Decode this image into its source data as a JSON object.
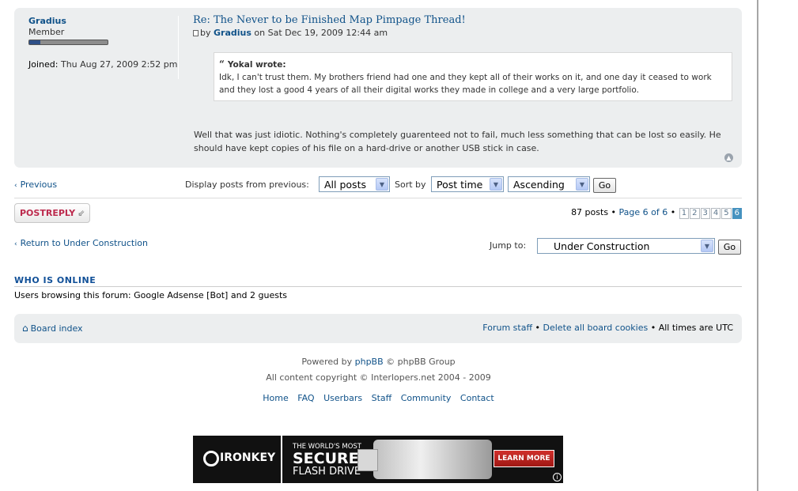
{
  "post": {
    "author_name": "Gradius",
    "rank": "Member",
    "joined_label": "Joined:",
    "joined_value": "Thu Aug 27, 2009 2:52 pm",
    "title": "Re: The Never to be Finished Map Pimpage Thread!",
    "by_prefix": "by",
    "by_name": "Gradius",
    "by_date": "on Sat Dec 19, 2009 12:44 am",
    "quote_author": "Yokal wrote:",
    "quote_text": "Idk, I can't trust them. My brothers friend had one and they kept all of their works on it, and one day it ceased to work and they lost a good 4 years of all their digital works they made in college and a very large portfolio.",
    "message": "Well that was just idiotic. Nothing's completely guarenteed not to fail, much less something that can be lost so easily. He should have kept copies of his file on a hard-drive or another USB stick in case."
  },
  "controls": {
    "previous": "Previous",
    "display_label": "Display posts from previous:",
    "display_value": "All posts",
    "sort_label": "Sort by",
    "sort_value": "Post time",
    "order_value": "Ascending",
    "go": "Go"
  },
  "postreply": {
    "label_post": "POST",
    "label_reply": "REPLY"
  },
  "pagination": {
    "count": "87 posts",
    "page_text": "Page 6 of 6",
    "pages": [
      "1",
      "2",
      "3",
      "4",
      "5",
      "6"
    ],
    "current": "6"
  },
  "jump": {
    "return_text": "Return to Under Construction",
    "label": "Jump to:",
    "value": "Under Construction",
    "go": "Go"
  },
  "whois": {
    "title": "WHO IS ONLINE",
    "text": "Users browsing this forum: Google Adsense [Bot] and 2 guests"
  },
  "navbar": {
    "board_index": "Board index",
    "forum_staff": "Forum staff",
    "delete_cookies": "Delete all board cookies",
    "times": "All times are UTC"
  },
  "footer": {
    "powered_prefix": "Powered by",
    "powered_link": "phpBB",
    "powered_suffix": "© phpBB Group",
    "copyright": "All content copyright © Interlopers.net 2004 - 2009",
    "links": [
      "Home",
      "FAQ",
      "Userbars",
      "Staff",
      "Community",
      "Contact"
    ]
  },
  "banner": {
    "brand": "IRONKEY",
    "line1": "THE WORLD'S MOST",
    "line2": "SECURE",
    "line3": "FLASH DRIVE",
    "cta": "LEARN MORE"
  }
}
